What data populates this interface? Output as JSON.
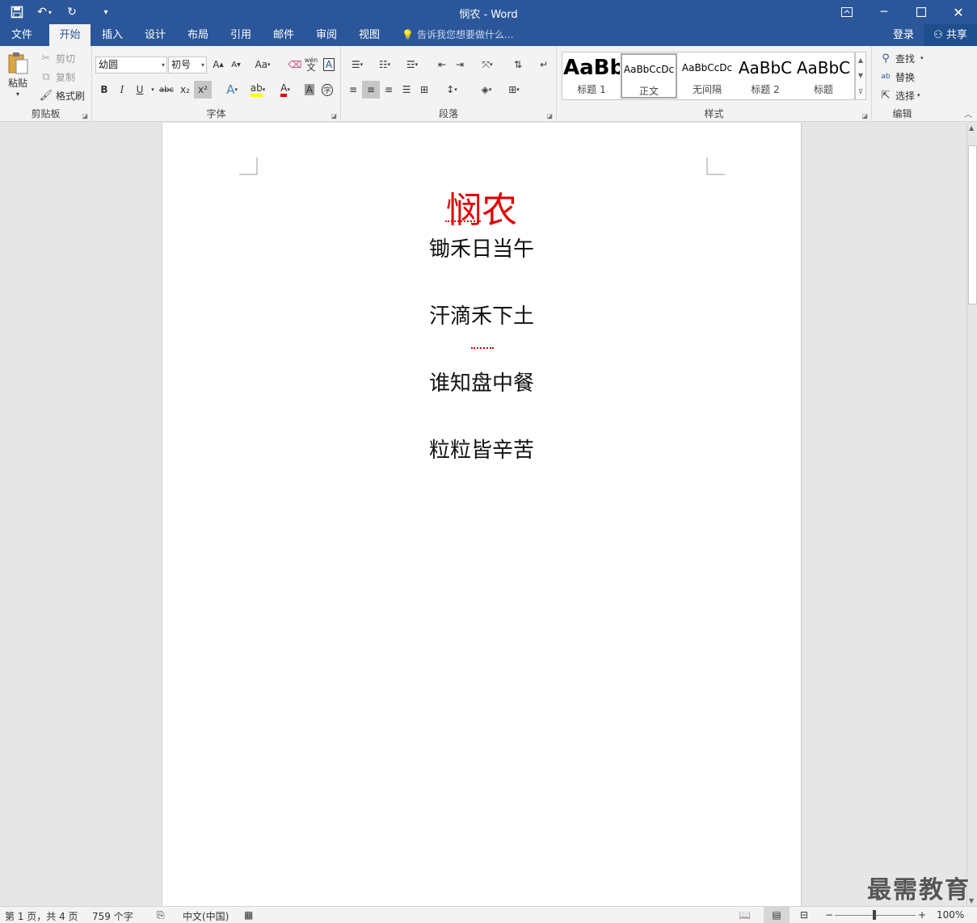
{
  "window": {
    "title": "悯农 - Word"
  },
  "qat": {
    "save_icon": "save-icon",
    "undo_icon": "undo-icon",
    "redo_icon": "redo-icon",
    "customize_icon": "customize-icon"
  },
  "tabs": [
    "文件",
    "开始",
    "插入",
    "设计",
    "布局",
    "引用",
    "邮件",
    "审阅",
    "视图"
  ],
  "active_tab": "开始",
  "tell_me": {
    "placeholder": "告诉我您想要做什么..."
  },
  "account": {
    "login": "登录",
    "share": "共享"
  },
  "clipboard": {
    "group": "剪贴板",
    "paste": "粘贴",
    "cut": "剪切",
    "copy": "复制",
    "format_painter": "格式刷"
  },
  "font": {
    "group": "字体",
    "name": "幼圆",
    "size": "初号",
    "aa": "Aa",
    "bold": "B",
    "italic": "I",
    "underline": "U",
    "strike": "abc",
    "subscript": "x₂",
    "superscript": "x²",
    "text_color": "A",
    "phonetic_top": "wén",
    "phonetic_bottom": "文",
    "border_char": "A",
    "shade_char": "A",
    "enclose_char": "字"
  },
  "paragraph": {
    "group": "段落"
  },
  "styles": {
    "group": "样式",
    "items": [
      {
        "preview": "AaBb",
        "name": "标题 1"
      },
      {
        "preview": "AaBbCcDc",
        "name": "正文"
      },
      {
        "preview": "AaBbCcDc",
        "name": "无间隔"
      },
      {
        "preview": "AaBbC",
        "name": "标题 2"
      },
      {
        "preview": "AaBbC",
        "name": "标题"
      }
    ]
  },
  "editing": {
    "group": "编辑",
    "find": "查找",
    "replace": "替换",
    "select": "选择"
  },
  "document": {
    "title": "悯农",
    "lines": [
      "锄禾日当午",
      "汗滴禾下土",
      "谁知盘中餐",
      "粒粒皆辛苦"
    ]
  },
  "status": {
    "page": "第 1 页，共 4 页",
    "words": "759 个字",
    "language": "中文(中国)",
    "zoom": "100%"
  },
  "watermark": "最需教育",
  "colors": {
    "accent": "#2b579a",
    "title_red": "#e00000"
  }
}
